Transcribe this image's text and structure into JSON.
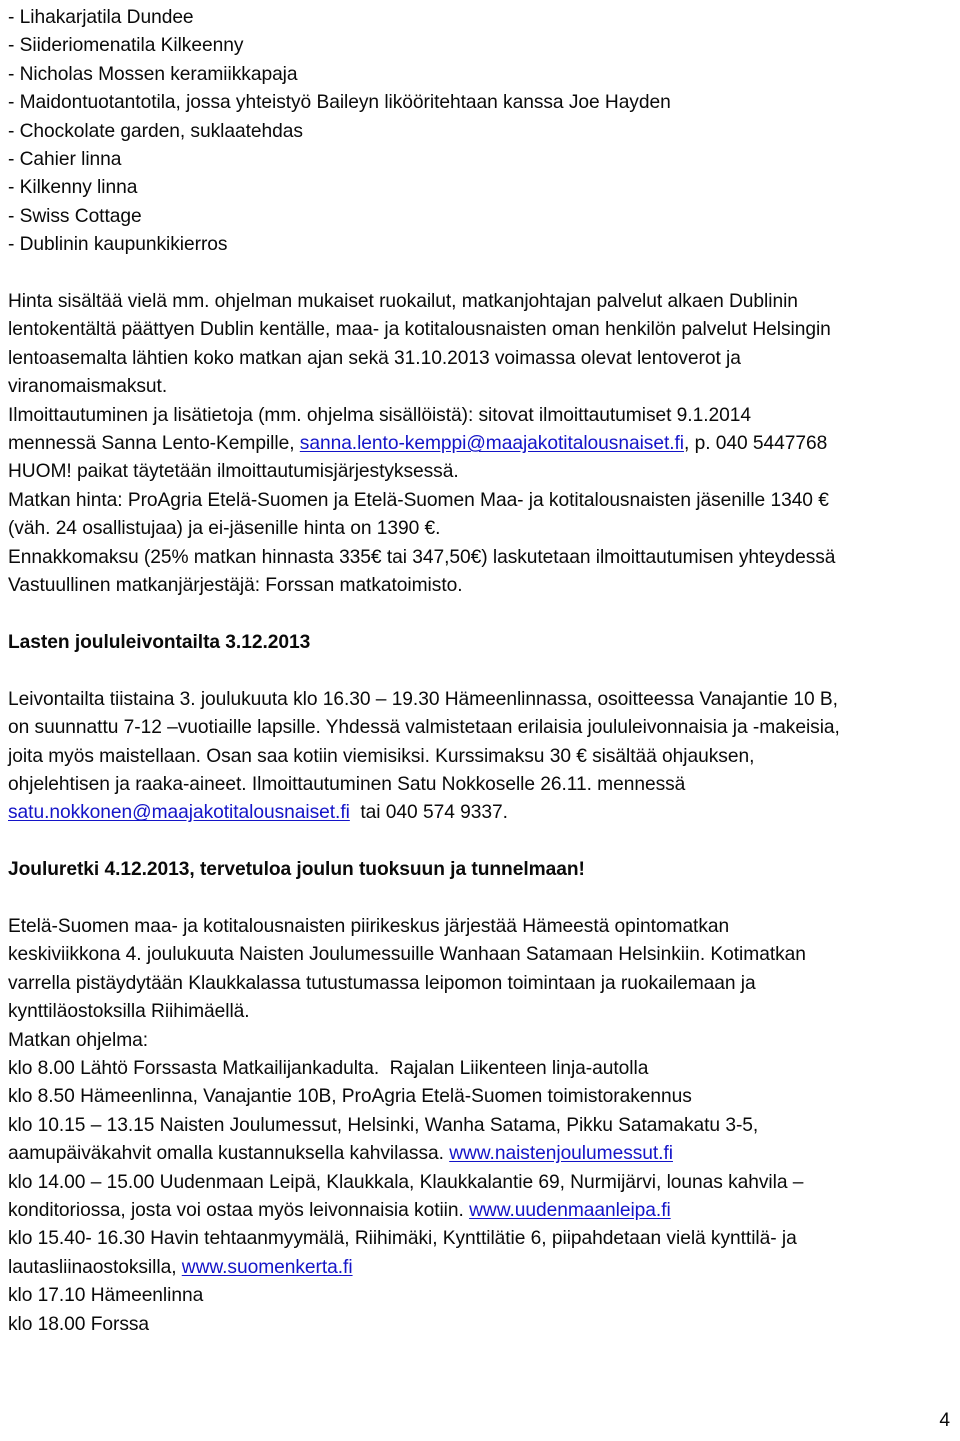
{
  "document": {
    "page_number": "4",
    "link_color": "#1414C8",
    "text_color": "#0A0A0A",
    "background_color": "#FFFFFF"
  },
  "bullets": [
    "- Lihakarjatila Dundee",
    "- Siideriomenatila Kilkeenny",
    "- Nicholas Mossen keramiikkapaja",
    "- Maidontuotantotila, jossa yhteistyö Baileyn likööritehtaan kanssa Joe Hayden",
    "- Chockolate garden, suklaatehdas",
    "- Cahier linna",
    "- Kilkenny linna",
    "- Swiss Cottage",
    "- Dublinin kaupunkikierros"
  ],
  "trip_info": {
    "line1": "Hinta sisältää vielä mm. ohjelman mukaiset ruokailut, matkanjohtajan palvelut alkaen Dublinin",
    "line2": "lentokentältä päättyen Dublin kentälle, maa- ja kotitalousnaisten oman henkilön palvelut Helsingin",
    "line3": "lentoasemalta lähtien koko matkan ajan sekä 31.10.2013 voimassa olevat lentoverot ja",
    "line4": "viranomaismaksut.",
    "line5": "Ilmoittautuminen ja lisätietoja (mm. ohjelma sisällöistä): sitovat ilmoittautumiset 9.1.2014",
    "line6_before": "mennessä Sanna Lento-Kempille, ",
    "line6_link": "sanna.lento-kemppi@maajakotitalousnaiset.fi",
    "line6_after": ", p. 040 5447768",
    "line7": "HUOM! paikat täytetään ilmoittautumisjärjestyksessä.",
    "line8": "Matkan hinta: ProAgria Etelä-Suomen ja Etelä-Suomen Maa- ja kotitalousnaisten jäsenille 1340 €",
    "line9": "(väh. 24 osallistujaa) ja ei-jäsenille hinta on 1390 €.",
    "line10": "Ennakkomaksu (25% matkan hinnasta 335€ tai 347,50€) laskutetaan ilmoittautumisen yhteydessä",
    "line11": "Vastuullinen matkanjärjestäjä: Forssan matkatoimisto."
  },
  "baking_event": {
    "heading": "Lasten joululeivontailta 3.12.2013",
    "line1": "Leivontailta tiistaina 3. joulukuuta klo 16.30 – 19.30 Hämeenlinnassa, osoitteessa Vanajantie 10 B,",
    "line2": "on suunnattu 7-12 –vuotiaille lapsille. Yhdessä valmistetaan erilaisia joululeivonnaisia ja -makeisia,",
    "line3": "joita myös maistellaan. Osan saa kotiin viemisiksi. Kurssimaksu 30 € sisältää ohjauksen,",
    "line4": "ohjelehtisen ja raaka-aineet. Ilmoittautuminen Satu Nokkoselle 26.11. mennessä",
    "line5_link": "satu.nokkonen@maajakotitalousnaiset.fi",
    "line5_after": "  tai 040 574 9337."
  },
  "christmas_trip": {
    "heading": "Jouluretki 4.12.2013, tervetuloa joulun tuoksuun ja tunnelmaan!",
    "intro1": "Etelä-Suomen maa- ja kotitalousnaisten piirikeskus järjestää Hämeestä opintomatkan",
    "intro2": "keskiviikkona 4. joulukuuta Naisten Joulumessuille Wanhaan Satamaan Helsinkiin. Kotimatkan",
    "intro3": "varrella pistäydytään Klaukkalassa tutustumassa leipomon toimintaan ja ruokailemaan ja",
    "intro4": "kynttiläostoksilla Riihimäellä.",
    "schedule_label": "Matkan ohjelma:",
    "sched1": "klo 8.00 Lähtö Forssasta Matkailijankadulta.  Rajalan Liikenteen linja-autolla",
    "sched2": "klo 8.50 Hämeenlinna, Vanajantie 10B, ProAgria Etelä-Suomen toimistorakennus",
    "sched3": "klo 10.15 – 13.15 Naisten Joulumessut, Helsinki, Wanha Satama, Pikku Satamakatu 3-5,",
    "sched4_before": "aamupäiväkahvit omalla kustannuksella kahvilassa. ",
    "sched4_link": "www.naistenjoulumessut.fi",
    "sched5": "klo 14.00 – 15.00 Uudenmaan Leipä, Klaukkala, Klaukkalantie 69, Nurmijärvi, lounas kahvila –",
    "sched6_before": "konditoriossa, josta voi ostaa myös leivonnaisia kotiin. ",
    "sched6_link": "www.uudenmaanleipa.fi",
    "sched7": "klo 15.40- 16.30 Havin tehtaanmyymälä, Riihimäki, Kynttilätie 6, piipahdetaan vielä kynttilä- ja",
    "sched8_before": "lautasliinaostoksilla, ",
    "sched8_link": "www.suomenkerta.fi",
    "sched9": "klo 17.10 Hämeenlinna",
    "sched10": "klo 18.00 Forssa"
  }
}
